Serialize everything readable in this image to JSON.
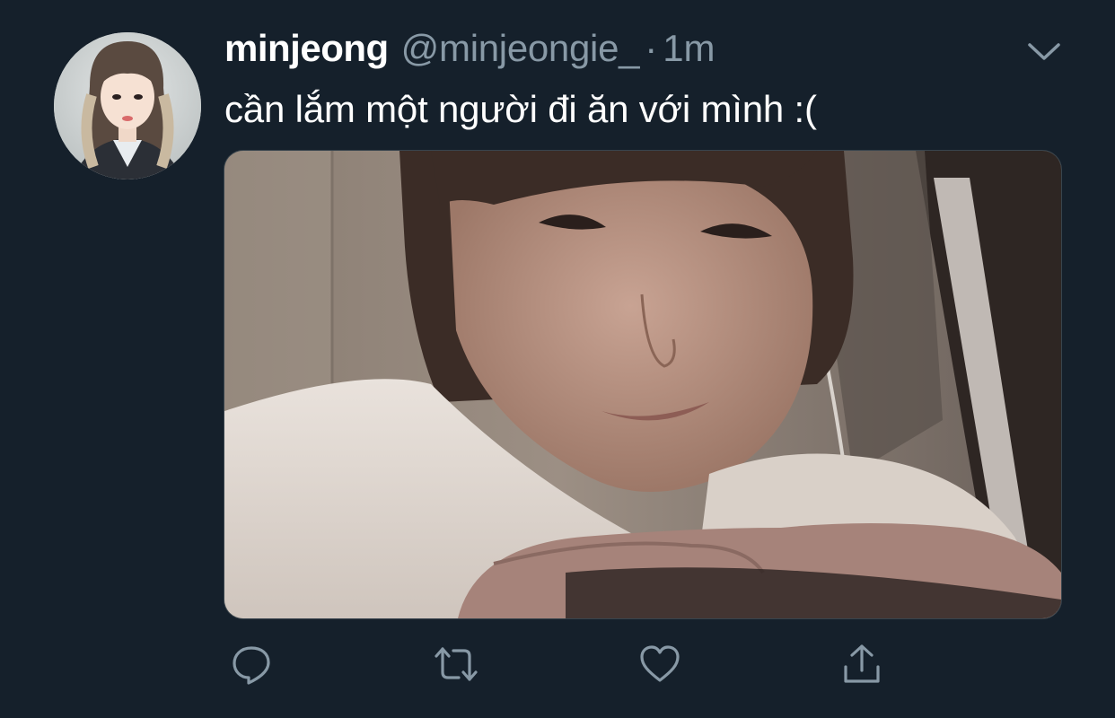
{
  "tweet": {
    "display_name": "minjeong",
    "handle": "@minjeongie_",
    "separator": "·",
    "timestamp": "1m",
    "text": "cần lắm một người đi ăn với mình :("
  },
  "icons": {
    "menu": "chevron-down-icon",
    "reply": "reply-icon",
    "retweet": "retweet-icon",
    "like": "heart-icon",
    "share": "share-icon"
  },
  "colors": {
    "background": "#15202b",
    "text_primary": "#ffffff",
    "text_secondary": "#8899a6",
    "border": "#38444d"
  }
}
